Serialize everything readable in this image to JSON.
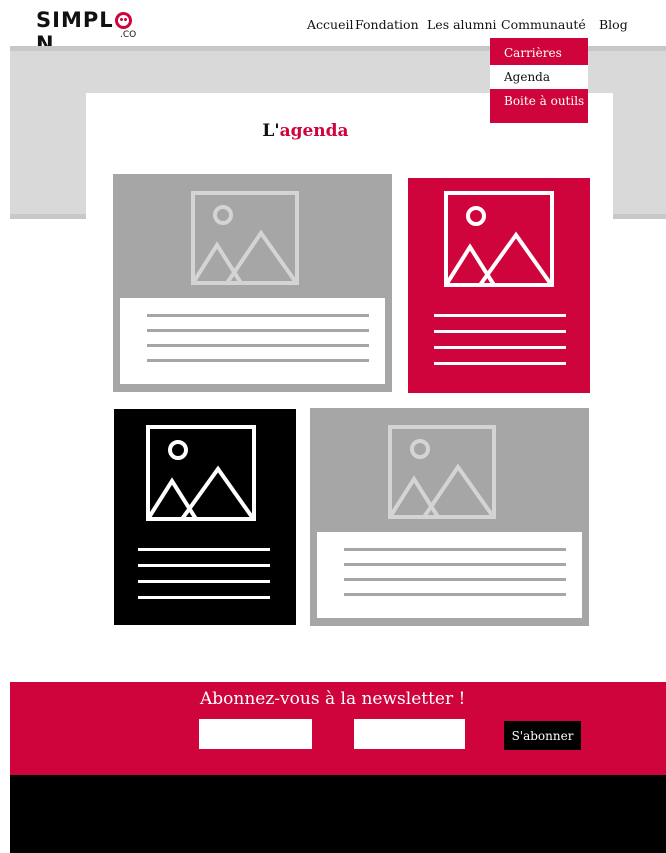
{
  "brand": {
    "logo_text_before": "SIMPL",
    "logo_text_after": "N",
    "logo_suffix": ".CO",
    "accent_color": "#d0043c"
  },
  "nav": {
    "items": [
      {
        "label": "Accueil"
      },
      {
        "label": "Fondation"
      },
      {
        "label": "Les alumni"
      },
      {
        "label": "Communauté"
      },
      {
        "label": "Blog"
      }
    ],
    "dropdown": {
      "items": [
        {
          "label": "Carrières"
        },
        {
          "label": "Agenda",
          "active": true
        },
        {
          "label": "Boite à outils"
        }
      ]
    }
  },
  "section": {
    "title_prefix": "L'",
    "title_accent": "agenda"
  },
  "cards": [
    {
      "theme": "grey",
      "icon": "image-placeholder-icon"
    },
    {
      "theme": "red",
      "icon": "image-placeholder-icon"
    },
    {
      "theme": "black",
      "icon": "image-placeholder-icon"
    },
    {
      "theme": "grey",
      "icon": "image-placeholder-icon"
    }
  ],
  "newsletter": {
    "title": "Abonnez-vous à la newsletter !",
    "input_1_value": "",
    "input_2_value": "",
    "button_label": "S'abonner"
  },
  "colors": {
    "red": "#d0043c",
    "grey": "#a6a6a6",
    "black": "#000000",
    "banner": "#d9d9d9"
  }
}
